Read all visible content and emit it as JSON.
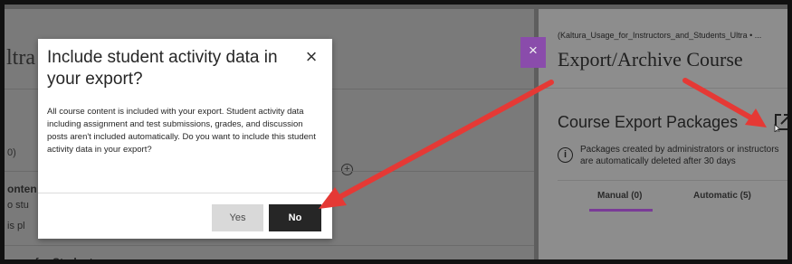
{
  "background_page": {
    "title_fragment": "ltra",
    "zero_fragment": "0)",
    "plus_glyph": "⊕",
    "row_content_fragment": "onten",
    "row_students_fragment": "o stu",
    "row_placed_fragment": "is pl",
    "row_usage_fragment": "sage for Students"
  },
  "panel": {
    "close_glyph": "×",
    "breadcrumb": "(Kaltura_Usage_for_Instructors_and_Students_Ultra • ...",
    "title": "Export/Archive Course",
    "section_heading": "Course Export Packages",
    "info_glyph": "i",
    "info_text": "Packages created by administrators or instructors are automatically deleted after 30 days",
    "tabs": [
      {
        "label": "Manual (0)",
        "selected": true
      },
      {
        "label": "Automatic (5)",
        "selected": false
      }
    ]
  },
  "modal": {
    "title": "Include student activity data in your export?",
    "close_glyph": "×",
    "body": "All course content is included with your export. Student activity data including assignment and test submissions, grades, and discussion posts aren't included automatically. Do you want to include this student activity data in your export?",
    "yes_label": "Yes",
    "no_label": "No"
  },
  "colors": {
    "accent_purple": "#8a4cab",
    "arrow_red": "#e53935",
    "primary_button": "#262626"
  },
  "annotations": [
    {
      "type": "arrow",
      "from": "panel-title",
      "to": "open-icon"
    },
    {
      "type": "arrow",
      "from": "panel-title",
      "to": "no-button"
    }
  ]
}
